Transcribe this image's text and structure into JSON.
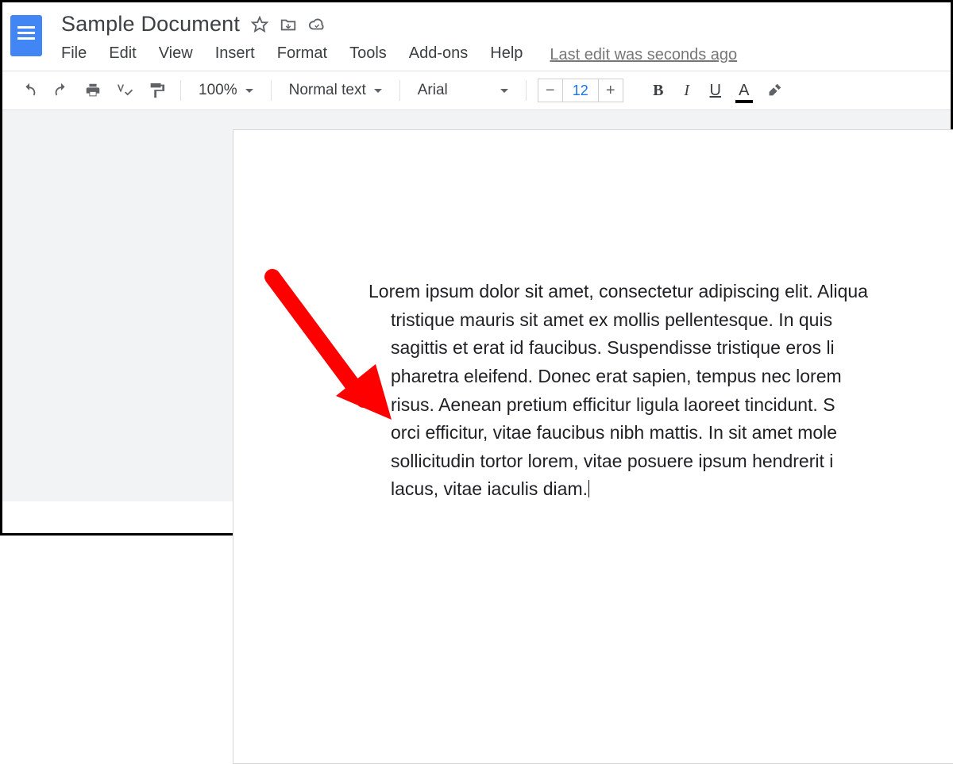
{
  "header": {
    "title": "Sample Document",
    "menus": [
      "File",
      "Edit",
      "View",
      "Insert",
      "Format",
      "Tools",
      "Add-ons",
      "Help"
    ],
    "last_edit": "Last edit was seconds ago"
  },
  "toolbar": {
    "zoom": "100%",
    "style": "Normal text",
    "font": "Arial",
    "font_size": "12",
    "minus": "−",
    "plus": "+",
    "bold": "B",
    "italic": "I",
    "underline": "U",
    "text_color": "A"
  },
  "document": {
    "body": "Lorem ipsum dolor sit amet, consectetur adipiscing elit. Aliqua\ntristique mauris sit amet ex mollis pellentesque. In quis \nsagittis et erat id faucibus. Suspendisse tristique eros li\npharetra eleifend. Donec erat sapien, tempus nec lorem\nrisus. Aenean pretium efficitur ligula laoreet tincidunt. S\norci efficitur, vitae faucibus nibh mattis. In sit amet mole\nsollicitudin tortor lorem, vitae posuere ipsum hendrerit i\nlacus, vitae iaculis diam."
  }
}
